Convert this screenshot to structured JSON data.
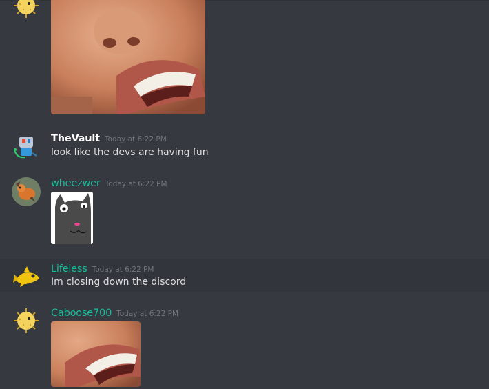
{
  "messages": [
    {
      "author": "",
      "author_color": "#f1c40f",
      "timestamp": "",
      "text": "",
      "avatar_icon": "pufferfish-icon",
      "attachment": "face-closeup-image"
    },
    {
      "author": "TheVault",
      "author_color": "#ffffff",
      "timestamp": "Today at 6:22 PM",
      "text": "look like the devs are having fun",
      "avatar_icon": "robot-icon"
    },
    {
      "author": "wheezwer",
      "author_color": "#1abc9c",
      "timestamp": "Today at 6:22 PM",
      "text": "",
      "avatar_icon": "orange-creature-icon",
      "attachment": "cat-drawing-image"
    },
    {
      "author": "Lifeless",
      "author_color": "#1abc9c",
      "timestamp": "Today at 6:22 PM",
      "text": "Im closing down the discord",
      "avatar_icon": "yellow-fish-icon"
    },
    {
      "author": "Caboose700",
      "author_color": "#1abc9c",
      "timestamp": "Today at 6:22 PM",
      "text": "",
      "avatar_icon": "pufferfish-icon",
      "attachment": "face-closeup-image"
    }
  ]
}
